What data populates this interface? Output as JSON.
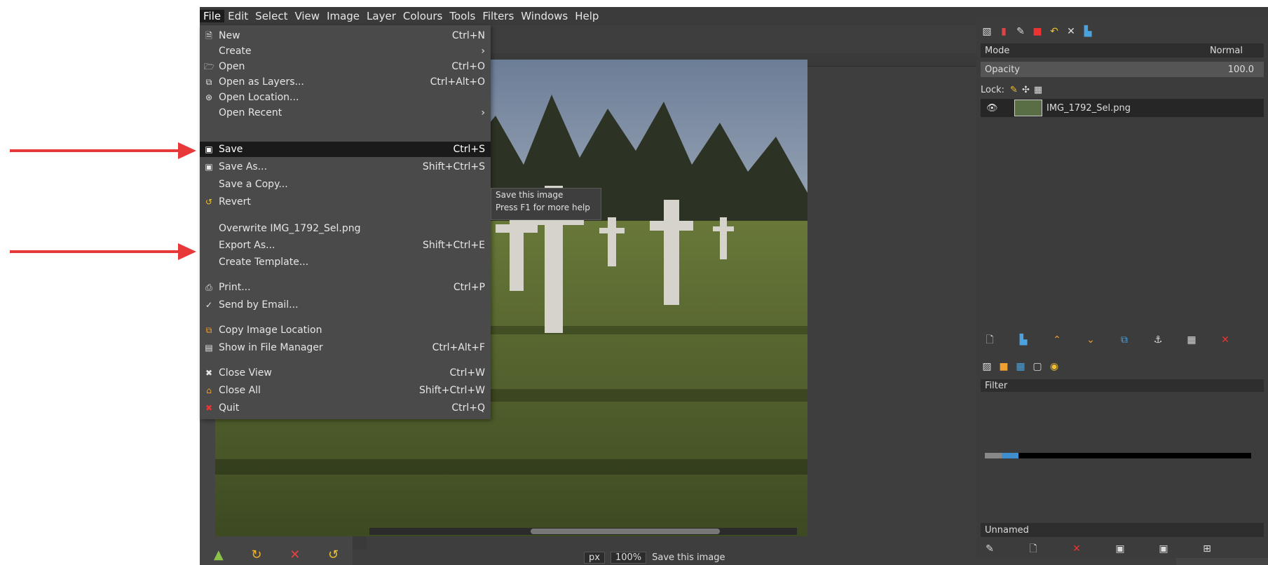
{
  "annotations": {
    "arrow_color": "#e8393a"
  },
  "menubar": [
    "File",
    "Edit",
    "Select",
    "View",
    "Image",
    "Layer",
    "Colours",
    "Tools",
    "Filters",
    "Windows",
    "Help"
  ],
  "file_menu": [
    {
      "icon": "new-file-icon",
      "glyph": "🗎",
      "label": "New",
      "shortcut": "Ctrl+N"
    },
    {
      "icon": "",
      "glyph": "",
      "label": "Create",
      "shortcut": "›"
    },
    {
      "icon": "open-folder-icon",
      "glyph": "🗁",
      "label": "Open",
      "shortcut": "Ctrl+O"
    },
    {
      "icon": "open-layers-icon",
      "glyph": "⧉",
      "label": "Open as Layers...",
      "shortcut": "Ctrl+Alt+O"
    },
    {
      "icon": "globe-icon",
      "glyph": "⊛",
      "label": "Open Location...",
      "shortcut": ""
    },
    {
      "icon": "",
      "glyph": "",
      "label": "Open Recent",
      "shortcut": "›"
    },
    {
      "icon": "save-icon",
      "glyph": "▣",
      "label": "Save",
      "shortcut": "Ctrl+S"
    },
    {
      "icon": "save-as-icon",
      "glyph": "▣",
      "label": "Save As...",
      "shortcut": "Shift+Ctrl+S"
    },
    {
      "icon": "",
      "glyph": "",
      "label": "Save a Copy...",
      "shortcut": ""
    },
    {
      "icon": "revert-icon",
      "glyph": "↺",
      "label": "Revert",
      "shortcut": ""
    },
    {
      "icon": "",
      "glyph": "",
      "label": "Overwrite IMG_1792_Sel.png",
      "shortcut": ""
    },
    {
      "icon": "",
      "glyph": "",
      "label": "Export As...",
      "shortcut": "Shift+Ctrl+E"
    },
    {
      "icon": "",
      "glyph": "",
      "label": "Create Template...",
      "shortcut": ""
    },
    {
      "icon": "print-icon",
      "glyph": "⎙",
      "label": "Print...",
      "shortcut": "Ctrl+P"
    },
    {
      "icon": "email-icon",
      "glyph": "✓",
      "label": "Send by Email...",
      "shortcut": ""
    },
    {
      "icon": "copy-location-icon",
      "glyph": "⧉",
      "label": "Copy Image Location",
      "shortcut": ""
    },
    {
      "icon": "file-manager-icon",
      "glyph": "▤",
      "label": "Show in File Manager",
      "shortcut": "Ctrl+Alt+F"
    },
    {
      "icon": "close-view-icon",
      "glyph": "✖",
      "label": "Close View",
      "shortcut": "Ctrl+W"
    },
    {
      "icon": "close-all-icon",
      "glyph": "⌂",
      "label": "Close All",
      "shortcut": "Shift+Ctrl+W"
    },
    {
      "icon": "quit-icon",
      "glyph": "✖",
      "label": "Quit",
      "shortcut": "Ctrl+Q"
    }
  ],
  "tooltip": {
    "line1": "Save this image",
    "line2": "Press F1 for more help"
  },
  "canvas_status": {
    "unit": "px",
    "zoom": "100%",
    "message": "Save this image"
  },
  "layers_panel": {
    "mode_label": "Mode",
    "mode_value": "Normal",
    "opacity_label": "Opacity",
    "opacity_value": "100.0",
    "lock_label": "Lock:",
    "layer_name": "IMG_1792_Sel.png"
  },
  "brushes_panel": {
    "filter_label": "Filter",
    "tag_value": "Unnamed"
  }
}
